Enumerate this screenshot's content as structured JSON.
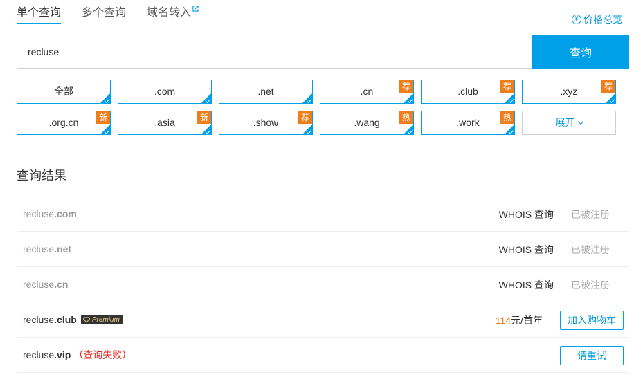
{
  "tabs": [
    {
      "label": "单个查询"
    },
    {
      "label": "多个查询"
    },
    {
      "label": "域名转入"
    }
  ],
  "price_link": {
    "icon": "yen-circle-icon",
    "label": "价格总览"
  },
  "search": {
    "value": "recluse",
    "button_label": "查询"
  },
  "suffixes": [
    {
      "label": "全部",
      "badge": ""
    },
    {
      "label": ".com",
      "badge": ""
    },
    {
      "label": ".net",
      "badge": ""
    },
    {
      "label": ".cn",
      "badge": "荐"
    },
    {
      "label": ".club",
      "badge": "荐"
    },
    {
      "label": ".xyz",
      "badge": "荐"
    },
    {
      "label": ".org.cn",
      "badge": "新"
    },
    {
      "label": ".asia",
      "badge": "新"
    },
    {
      "label": ".show",
      "badge": "荐"
    },
    {
      "label": ".wang",
      "badge": "热"
    },
    {
      "label": ".work",
      "badge": "热"
    }
  ],
  "expand_label": "展开",
  "results_title": "查询结果",
  "results": [
    {
      "name": "recluse",
      "suffix": ".com",
      "whois": "WHOIS 查询",
      "status": "已被注册"
    },
    {
      "name": "recluse",
      "suffix": ".net",
      "whois": "WHOIS 查询",
      "status": "已被注册"
    },
    {
      "name": "recluse",
      "suffix": ".cn",
      "whois": "WHOIS 查询",
      "status": "已被注册"
    },
    {
      "name": "recluse",
      "suffix": ".club",
      "premium": "Premium",
      "price_num": "114",
      "price_unit": "元/首年",
      "button": "加入购物车"
    },
    {
      "name": "recluse",
      "suffix": ".vip",
      "fail": "（查询失败）",
      "button": "请重试"
    }
  ],
  "colors": {
    "accent": "#00a0e9",
    "badge": "#ef7d1a",
    "error": "#e2231a"
  }
}
